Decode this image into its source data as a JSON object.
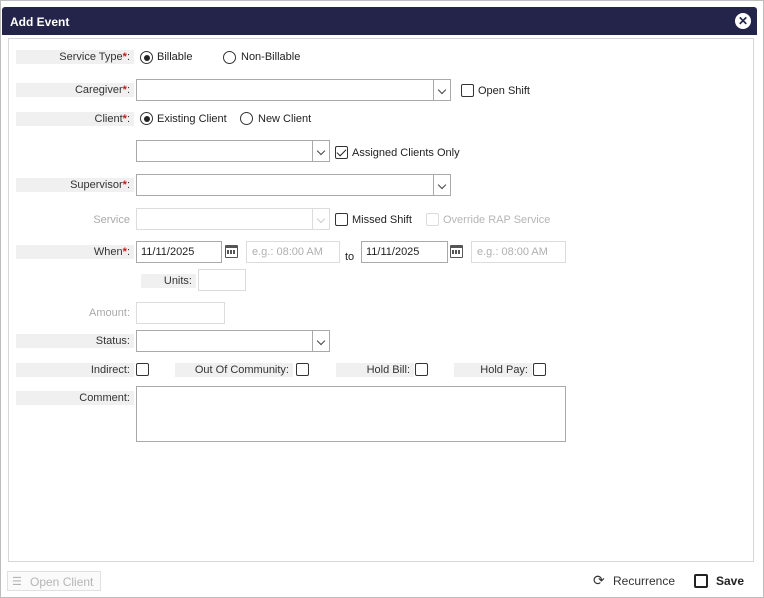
{
  "dialog": {
    "title": "Add Event",
    "close_glyph": "✕"
  },
  "service_type": {
    "label": "Service Type",
    "options": [
      "Billable",
      "Non-Billable"
    ],
    "selected": "Billable"
  },
  "caregiver": {
    "label": "Caregiver",
    "value": "",
    "open_shift_label": "Open Shift"
  },
  "client": {
    "label": "Client",
    "options": [
      "Existing Client",
      "New Client"
    ],
    "selected": "Existing Client",
    "assigned_only_label": "Assigned Clients Only"
  },
  "supervisor": {
    "label": "Supervisor",
    "value": ""
  },
  "service": {
    "label": "Service",
    "missed_shift_label": "Missed Shift",
    "override_label": "Override RAP Service"
  },
  "when": {
    "label": "When",
    "start_date": "11/11/2025",
    "start_time_placeholder": "e.g.: 08:00 AM",
    "to_label": "to",
    "end_date": "11/11/2025",
    "end_time_placeholder": "e.g.: 08:00 AM"
  },
  "units": {
    "label": "Units:"
  },
  "amount": {
    "label": "Amount:"
  },
  "status": {
    "label": "Status:"
  },
  "flags": {
    "indirect": "Indirect:",
    "out_of_community": "Out Of Community:",
    "hold_bill": "Hold Bill:",
    "hold_pay": "Hold Pay:"
  },
  "comment": {
    "label": "Comment:"
  },
  "footer": {
    "open_client": "Open Client",
    "recurrence": "Recurrence",
    "save": "Save"
  },
  "req_mark": "*",
  "colon": ":",
  "colors": {
    "titlebar": "#24234a",
    "required": "#c4161c"
  }
}
